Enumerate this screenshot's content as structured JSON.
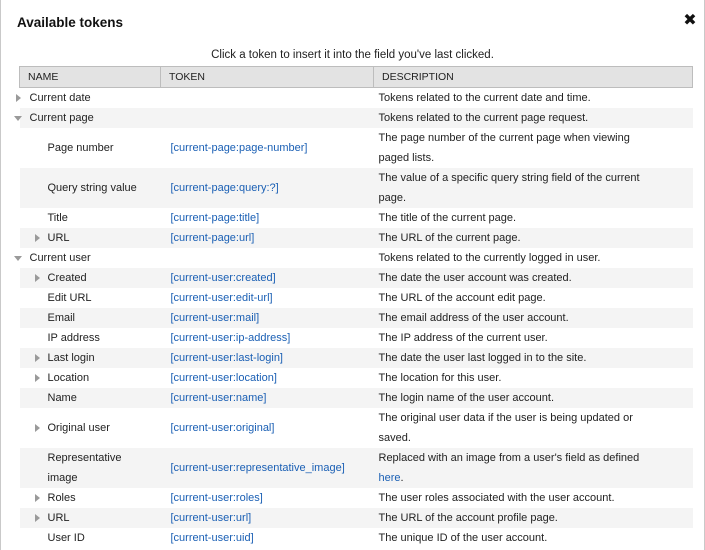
{
  "dialog": {
    "title": "Available tokens",
    "close_glyph": "✖",
    "instruction": "Click a token to insert it into the field you've last clicked."
  },
  "table": {
    "headers": [
      "NAME",
      "TOKEN",
      "DESCRIPTION"
    ],
    "rows": [
      {
        "name": "Current date",
        "token": "",
        "desc": "Tokens related to the current date and time."
      },
      {
        "name": "Current page",
        "token": "",
        "desc": "Tokens related to the current page request."
      },
      {
        "name": "Page number",
        "token": "[current-page:page-number]",
        "desc1": "The page number of the current page when viewing",
        "desc2": "paged lists."
      },
      {
        "name": "Query string value",
        "token": "[current-page:query:?]",
        "desc1": "The value of a specific query string field of the current",
        "desc2": "page."
      },
      {
        "name": "Title",
        "token": "[current-page:title]",
        "desc": "The title of the current page."
      },
      {
        "name": "URL",
        "token": "[current-page:url]",
        "desc": "The URL of the current page."
      },
      {
        "name": "Current user",
        "token": "",
        "desc": "Tokens related to the currently logged in user."
      },
      {
        "name": "Created",
        "token": "[current-user:created]",
        "desc": "The date the user account was created."
      },
      {
        "name": "Edit URL",
        "token": "[current-user:edit-url]",
        "desc": "The URL of the account edit page."
      },
      {
        "name": "Email",
        "token": "[current-user:mail]",
        "desc": "The email address of the user account."
      },
      {
        "name": "IP address",
        "token": "[current-user:ip-address]",
        "desc": "The IP address of the current user."
      },
      {
        "name": "Last login",
        "token": "[current-user:last-login]",
        "desc": "The date the user last logged in to the site."
      },
      {
        "name": "Location",
        "token": "[current-user:location]",
        "desc": "The location for this user."
      },
      {
        "name": "Name",
        "token": "[current-user:name]",
        "desc": "The login name of the user account."
      },
      {
        "name": "Original user",
        "token": "[current-user:original]",
        "desc1": "The original user data if the user is being updated or",
        "desc2": "saved."
      },
      {
        "name1": "Representative",
        "name2": "image",
        "token": "[current-user:representative_image]",
        "desc1": "Replaced with an image from a user's field as defined",
        "desc2_link": "here",
        "desc2_tail": "."
      },
      {
        "name": "Roles",
        "token": "[current-user:roles]",
        "desc": "The user roles associated with the user account."
      },
      {
        "name": "URL",
        "token": "[current-user:url]",
        "desc": "The URL of the account profile page."
      },
      {
        "name": "User ID",
        "token": "[current-user:uid]",
        "desc": "The unique ID of the user account."
      }
    ]
  }
}
